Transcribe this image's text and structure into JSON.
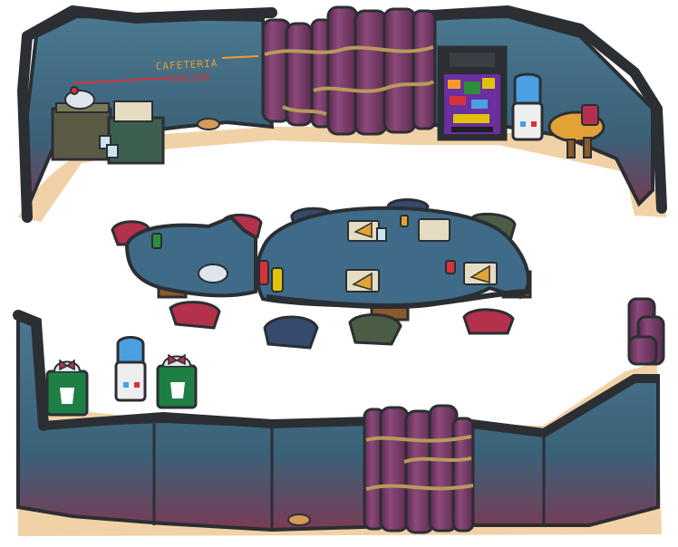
{
  "scene": {
    "signs": {
      "cafeteria": "CAFETERIA",
      "engine": "ENGINE"
    }
  },
  "colors": {
    "outline": "#2b2f33",
    "wall": "#3f6a82",
    "wall_dark": "#2f5064",
    "wall_stain": "#7a3b55",
    "floor": "#f1d2a6",
    "pipe": "#7b3a6a",
    "pipe_dark": "#5a2a4e",
    "rope": "#b69a5c",
    "table": "#3f6a88",
    "sign_orange": "#f39a2a",
    "sign_red": "#d8323a",
    "trash_green": "#1e7f45",
    "water_blue": "#4aa0e0"
  },
  "icons": [
    "recycle-icon",
    "trash-bag-bow-icon",
    "pizza-slice-icon",
    "ketchup-bottle-icon",
    "mustard-bottle-icon",
    "soda-can-icon",
    "cup-icon",
    "lamp-icon"
  ]
}
